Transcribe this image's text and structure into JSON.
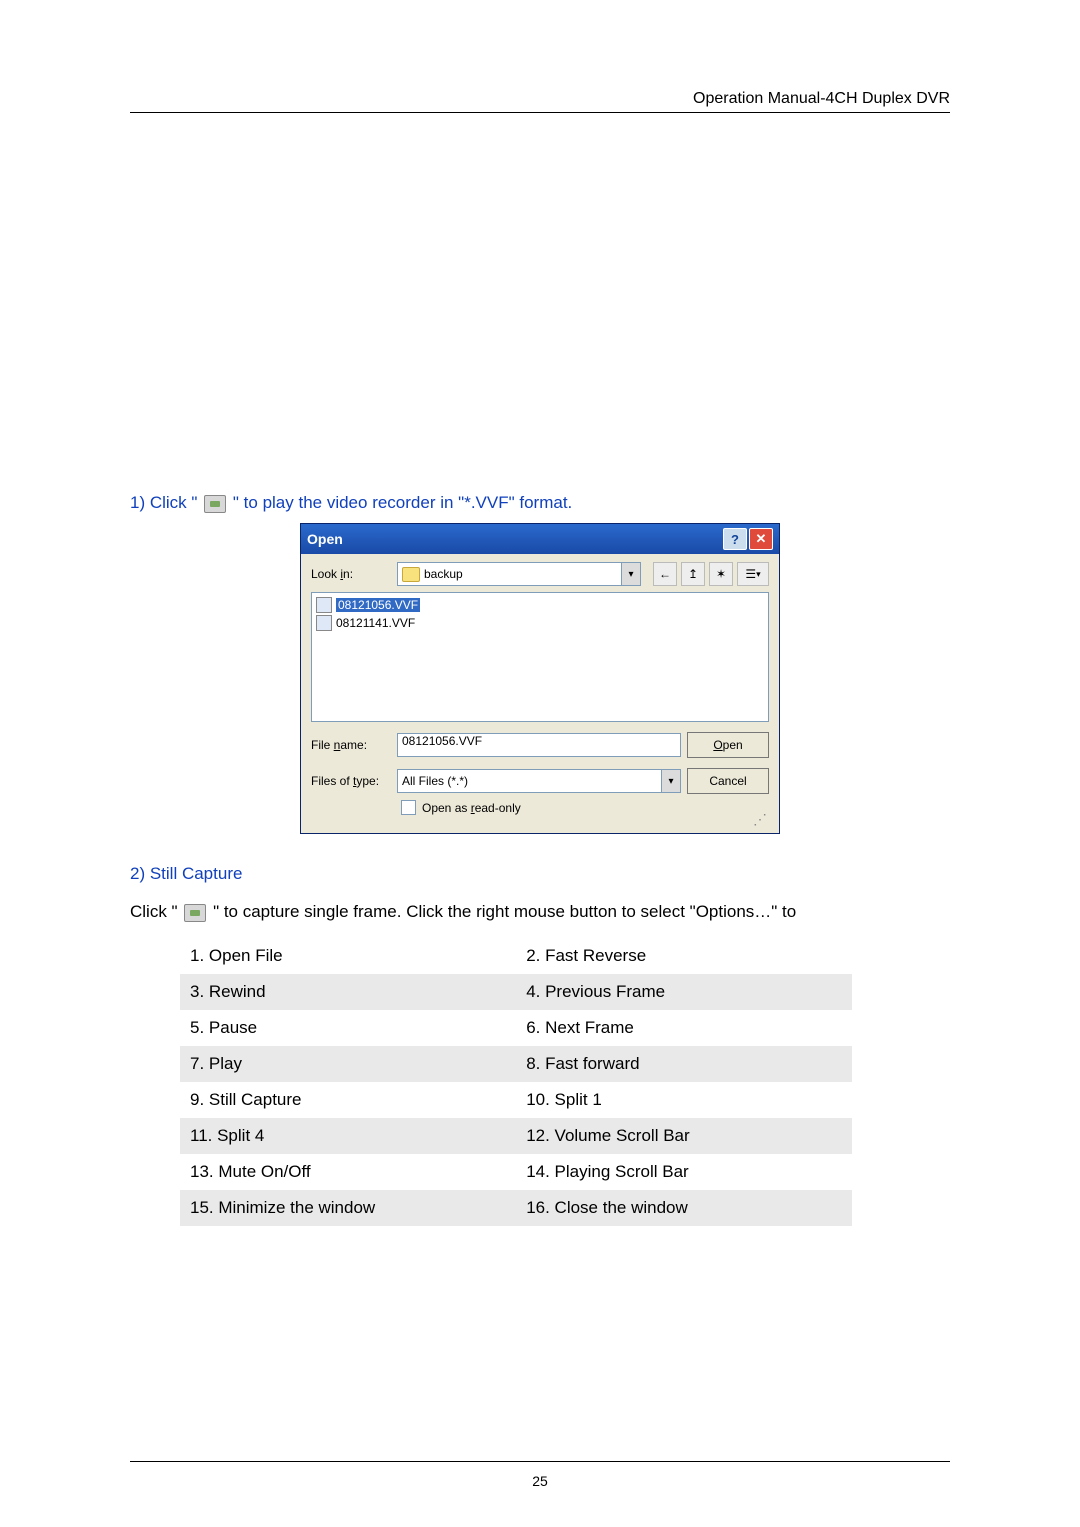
{
  "header": {
    "title": "Operation Manual-4CH Duplex DVR"
  },
  "step1": {
    "prefix": "1) Click \"",
    "suffix": "\" to play the video recorder in \"*.VVF\" format."
  },
  "dialog": {
    "title": "Open",
    "help_label": "?",
    "close_label": "✕",
    "look_in_label": "Look in:",
    "look_in_mnemonic_index": 5,
    "look_in_value": "backup",
    "icon_back": "←",
    "icon_up": "↥",
    "icon_new": "✶",
    "icon_view": "☰",
    "icon_view_more": "▾",
    "files": [
      {
        "name": "08121056.VVF",
        "selected": true
      },
      {
        "name": "08121141.VVF",
        "selected": false
      }
    ],
    "file_name_label": "File name:",
    "file_name_value": "08121056.VVF",
    "file_type_label": "Files of type:",
    "file_type_value": "All Files (*.*)",
    "open_button": "Open",
    "cancel_button": "Cancel",
    "read_only_label": "Open as read-only"
  },
  "step2_heading": "2) Still Capture",
  "body": {
    "prefix": "Click \"",
    "suffix": "\" to capture single frame. Click the right mouse button to select \"Options…\" to"
  },
  "features": [
    [
      "1. Open File",
      "2. Fast Reverse"
    ],
    [
      "3. Rewind",
      "4. Previous Frame"
    ],
    [
      "5. Pause",
      "6. Next Frame"
    ],
    [
      "7. Play",
      "8. Fast forward"
    ],
    [
      "9. Still Capture",
      "10. Split 1"
    ],
    [
      "11. Split 4",
      "12. Volume Scroll Bar"
    ],
    [
      "13. Mute On/Off",
      "14. Playing Scroll Bar"
    ],
    [
      "15. Minimize the window",
      "16. Close the window"
    ]
  ],
  "page_number": "25"
}
